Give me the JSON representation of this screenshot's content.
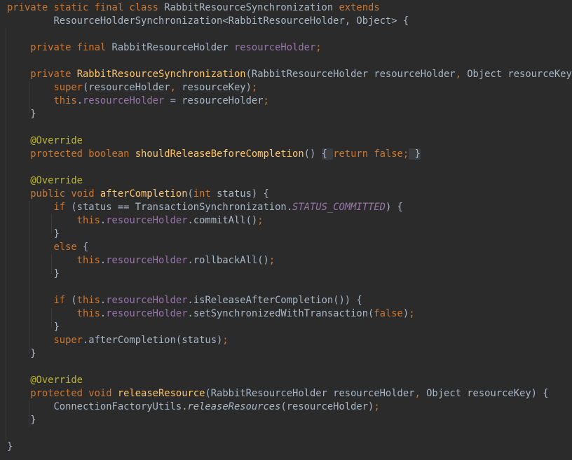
{
  "editor": {
    "language": "java",
    "theme": "Darcula",
    "colors": {
      "background": "#2b2b2b",
      "text": "#a9b7c6",
      "keyword": "#cc7832",
      "method": "#ffc66d",
      "field": "#9876aa",
      "annotation": "#bbb529",
      "fold_highlight": "#3a3d3f"
    },
    "lines": [
      {
        "tokens": [
          {
            "t": "private static final class ",
            "c": "kw"
          },
          {
            "t": "RabbitResourceSynchronization ",
            "c": "plain"
          },
          {
            "t": "extends",
            "c": "kw"
          }
        ]
      },
      {
        "tokens": [
          {
            "t": "        ResourceHolderSynchronization<RabbitResourceHolder, Object> {",
            "c": "plain"
          }
        ]
      },
      {
        "tokens": []
      },
      {
        "tokens": [
          {
            "t": "    private final ",
            "c": "kw"
          },
          {
            "t": "RabbitResourceHolder ",
            "c": "plain"
          },
          {
            "t": "resourceHolder",
            "c": "field"
          },
          {
            "t": ";",
            "c": "kw"
          }
        ]
      },
      {
        "tokens": []
      },
      {
        "tokens": [
          {
            "t": "    private ",
            "c": "kw"
          },
          {
            "t": "RabbitResourceSynchronization",
            "c": "fn"
          },
          {
            "t": "(RabbitResourceHolder resourceHolder",
            "c": "plain"
          },
          {
            "t": ", ",
            "c": "kw"
          },
          {
            "t": "Object resourceKey) {",
            "c": "plain"
          }
        ]
      },
      {
        "tokens": [
          {
            "t": "        super",
            "c": "kw"
          },
          {
            "t": "(resourceHolder",
            "c": "plain"
          },
          {
            "t": ", ",
            "c": "kw"
          },
          {
            "t": "resourceKey)",
            "c": "plain"
          },
          {
            "t": ";",
            "c": "kw"
          }
        ]
      },
      {
        "tokens": [
          {
            "t": "        this",
            "c": "kw"
          },
          {
            "t": ".",
            "c": "plain"
          },
          {
            "t": "resourceHolder",
            "c": "field"
          },
          {
            "t": " = resourceHolder",
            "c": "plain"
          },
          {
            "t": ";",
            "c": "kw"
          }
        ]
      },
      {
        "tokens": [
          {
            "t": "    }",
            "c": "plain"
          }
        ]
      },
      {
        "tokens": []
      },
      {
        "tokens": [
          {
            "t": "    @Override",
            "c": "ann"
          }
        ]
      },
      {
        "tokens": [
          {
            "t": "    protected boolean ",
            "c": "kw"
          },
          {
            "t": "shouldReleaseBeforeCompletion",
            "c": "fn"
          },
          {
            "t": "() ",
            "c": "plain"
          },
          {
            "t": "{ ",
            "c": "fold"
          },
          {
            "t": "return false",
            "c": "kw"
          },
          {
            "t": ";",
            "c": "kw"
          },
          {
            "t": " }",
            "c": "fold"
          }
        ]
      },
      {
        "tokens": []
      },
      {
        "tokens": [
          {
            "t": "    @Override",
            "c": "ann"
          }
        ]
      },
      {
        "tokens": [
          {
            "t": "    public void ",
            "c": "kw"
          },
          {
            "t": "afterCompletion",
            "c": "fn"
          },
          {
            "t": "(",
            "c": "plain"
          },
          {
            "t": "int ",
            "c": "kw"
          },
          {
            "t": "status) {",
            "c": "plain"
          }
        ]
      },
      {
        "tokens": [
          {
            "t": "        if ",
            "c": "kw"
          },
          {
            "t": "(status == TransactionSynchronization.",
            "c": "plain"
          },
          {
            "t": "STATUS_COMMITTED",
            "c": "const"
          },
          {
            "t": ") {",
            "c": "plain"
          }
        ]
      },
      {
        "tokens": [
          {
            "t": "            this",
            "c": "kw"
          },
          {
            "t": ".",
            "c": "plain"
          },
          {
            "t": "resourceHolder",
            "c": "field"
          },
          {
            "t": ".commitAll()",
            "c": "plain"
          },
          {
            "t": ";",
            "c": "kw"
          }
        ]
      },
      {
        "tokens": [
          {
            "t": "        }",
            "c": "plain"
          }
        ]
      },
      {
        "tokens": [
          {
            "t": "        else ",
            "c": "kw"
          },
          {
            "t": "{",
            "c": "plain"
          }
        ]
      },
      {
        "tokens": [
          {
            "t": "            this",
            "c": "kw"
          },
          {
            "t": ".",
            "c": "plain"
          },
          {
            "t": "resourceHolder",
            "c": "field"
          },
          {
            "t": ".rollbackAll()",
            "c": "plain"
          },
          {
            "t": ";",
            "c": "kw"
          }
        ]
      },
      {
        "tokens": [
          {
            "t": "        }",
            "c": "plain"
          }
        ]
      },
      {
        "tokens": []
      },
      {
        "tokens": [
          {
            "t": "        if ",
            "c": "kw"
          },
          {
            "t": "(",
            "c": "plain"
          },
          {
            "t": "this",
            "c": "kw"
          },
          {
            "t": ".",
            "c": "plain"
          },
          {
            "t": "resourceHolder",
            "c": "field"
          },
          {
            "t": ".isReleaseAfterCompletion()) {",
            "c": "plain"
          }
        ]
      },
      {
        "tokens": [
          {
            "t": "            this",
            "c": "kw"
          },
          {
            "t": ".",
            "c": "plain"
          },
          {
            "t": "resourceHolder",
            "c": "field"
          },
          {
            "t": ".setSynchronizedWithTransaction(",
            "c": "plain"
          },
          {
            "t": "false",
            "c": "kw"
          },
          {
            "t": ")",
            "c": "plain"
          },
          {
            "t": ";",
            "c": "kw"
          }
        ]
      },
      {
        "tokens": [
          {
            "t": "        }",
            "c": "plain"
          }
        ]
      },
      {
        "tokens": [
          {
            "t": "        super",
            "c": "kw"
          },
          {
            "t": ".afterCompletion(status)",
            "c": "plain"
          },
          {
            "t": ";",
            "c": "kw"
          }
        ]
      },
      {
        "tokens": [
          {
            "t": "    }",
            "c": "plain"
          }
        ]
      },
      {
        "tokens": []
      },
      {
        "tokens": [
          {
            "t": "    @Override",
            "c": "ann"
          }
        ]
      },
      {
        "tokens": [
          {
            "t": "    protected void ",
            "c": "kw"
          },
          {
            "t": "releaseResource",
            "c": "fn"
          },
          {
            "t": "(RabbitResourceHolder resourceHolder",
            "c": "plain"
          },
          {
            "t": ", ",
            "c": "kw"
          },
          {
            "t": "Object resourceKey) {",
            "c": "plain"
          }
        ]
      },
      {
        "tokens": [
          {
            "t": "        ConnectionFactoryUtils.",
            "c": "plain"
          },
          {
            "t": "releaseResources",
            "c": "static-call"
          },
          {
            "t": "(resourceHolder)",
            "c": "plain"
          },
          {
            "t": ";",
            "c": "kw"
          }
        ]
      },
      {
        "tokens": [
          {
            "t": "    }",
            "c": "plain"
          }
        ]
      },
      {
        "tokens": []
      },
      {
        "tokens": [
          {
            "t": "}",
            "c": "plain"
          }
        ]
      }
    ]
  }
}
